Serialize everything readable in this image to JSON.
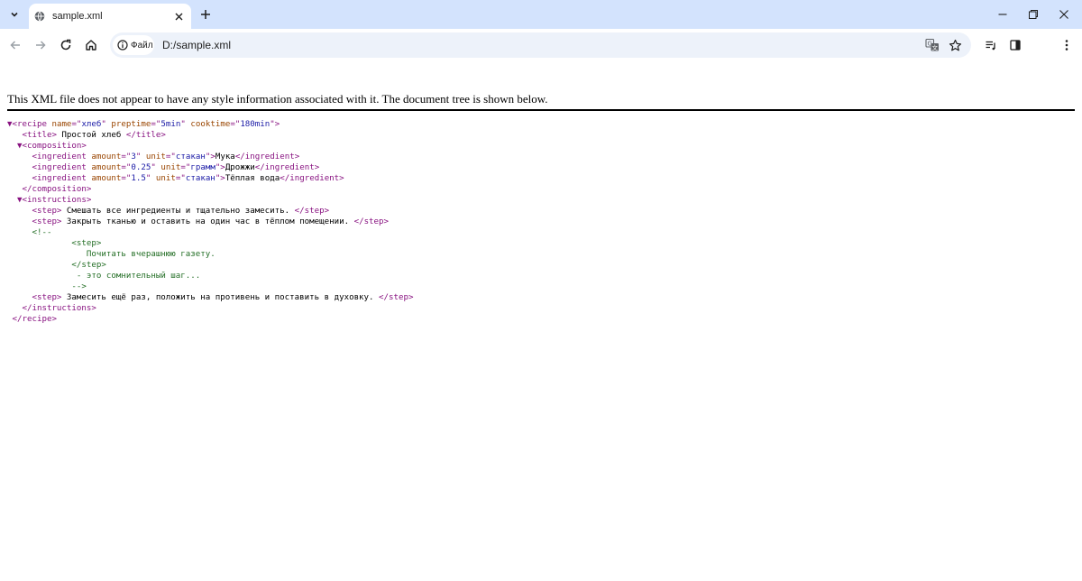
{
  "tab": {
    "title": "sample.xml",
    "favicon": "globe-icon"
  },
  "toolbar": {
    "site_chip_label": "Файл",
    "url": "D:/sample.xml"
  },
  "notice": "This XML file does not appear to have any style information associated with it. The document tree is shown below.",
  "xml": {
    "recipe_name": "хлеб",
    "preptime": "5min",
    "cooktime": "180min",
    "title": " Простой хлеб ",
    "ingredients": [
      {
        "amount": "3",
        "unit": "стакан",
        "text": "Мука"
      },
      {
        "amount": "0.25",
        "unit": "грамм",
        "text": "Дрожжи"
      },
      {
        "amount": "1.5",
        "unit": "стакан",
        "text": "Тёплая вода"
      }
    ],
    "steps": [
      " Смешать все ингредиенты и тщательно замесить. ",
      " Закрыть тканью и оставить на один час в тёплом помещении. "
    ],
    "comment": {
      "open": "<!--",
      "step_open": "<step>",
      "step_text": "Почитать вчерашнюю газету.",
      "step_close": "</step>",
      "note": "- это сомнительный шаг...",
      "close": "-->"
    },
    "final_step": " Замесить ещё раз, положить на противень и поставить в духовку. "
  },
  "colors": {
    "tabstrip_bg": "#d3e3fd",
    "omnibox_bg": "#edf2fa",
    "tag": "#881280",
    "attr_name": "#994500",
    "attr_value": "#1a1aa6",
    "comment": "#236e25"
  }
}
